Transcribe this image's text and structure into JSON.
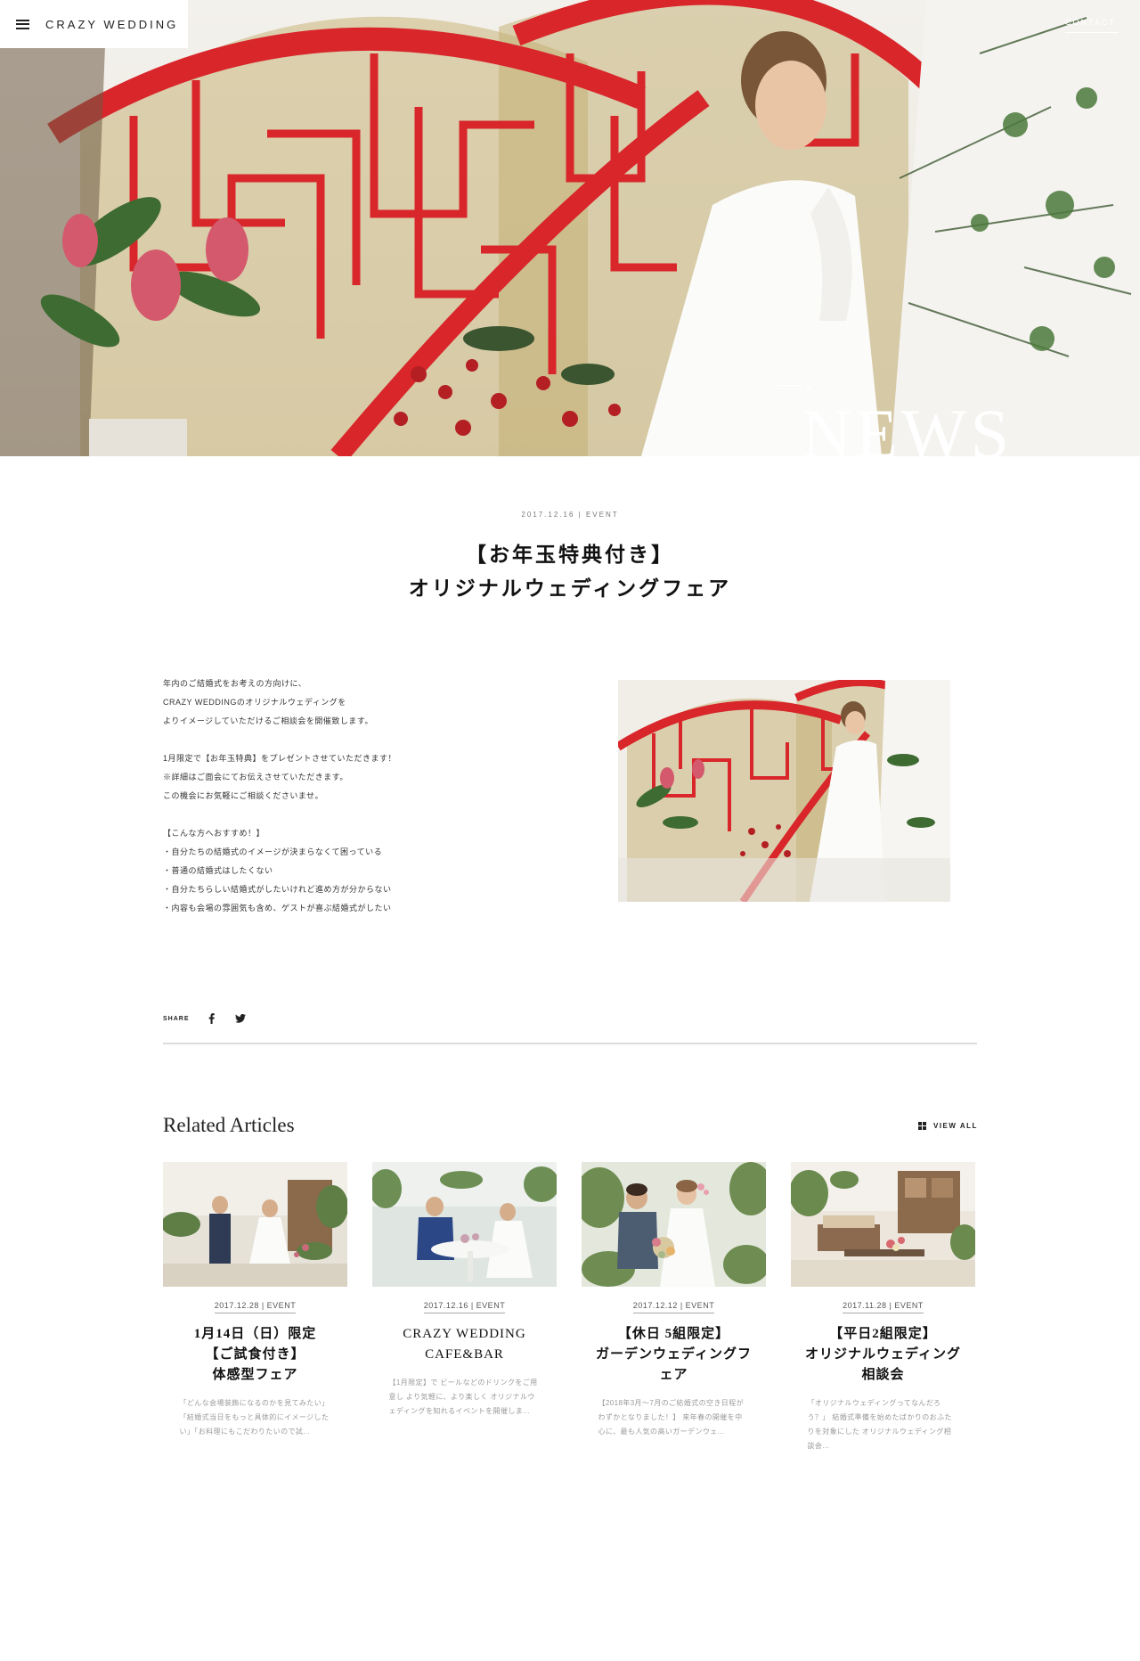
{
  "header": {
    "brand": "CRAZY WEDDING",
    "contact_label": "CONTACT",
    "hero_title": "NEWS"
  },
  "article": {
    "meta": "2017.12.16 | EVENT",
    "title_lines": [
      "【お年玉特典付き】",
      "オリジナルウェディングフェア"
    ],
    "paragraphs": [
      [
        "年内のご結婚式をお考えの方向けに、",
        "CRAZY WEDDINGのオリジナルウェディングを",
        "よりイメージしていただけるご相談会を開催致します。"
      ],
      [
        "1月限定で【お年玉特典】をプレゼントさせていただきます！",
        "※詳細はご面会にてお伝えさせていただきます。",
        "この機会にお気軽にご相談くださいませ。"
      ],
      [
        "【こんな方へおすすめ！】",
        "・自分たちの結婚式のイメージが決まらなくて困っている",
        "・普通の結婚式はしたくない",
        "・自分たちらしい結婚式がしたいけれど進め方が分からない",
        "・内容も会場の雰囲気も含め、ゲストが喜ぶ結婚式がしたい"
      ]
    ]
  },
  "share": {
    "label": "SHARE",
    "icons": [
      "facebook-icon",
      "twitter-icon"
    ]
  },
  "related": {
    "title": "Related Articles",
    "view_all_label": "VIEW ALL",
    "cards": [
      {
        "meta": "2017.12.28 | EVENT",
        "title_lines": [
          "1月14日（日）限定",
          "【ご試食付き】",
          "体感型フェア"
        ],
        "excerpt": "「どんな会場装飾になるのかを見てみたい」「結婚式当日をもっと具体的にイメージしたい」「お料理にもこだわりたいので試..."
      },
      {
        "meta": "2017.12.16 | EVENT",
        "title_lines": [
          "CRAZY WEDDING",
          "CAFE&BAR"
        ],
        "excerpt": "【1月限定】で ビールなどのドリンクをご用意し より気軽に、より楽しく オリジナルウェディングを知れるイベントを開催しま..."
      },
      {
        "meta": "2017.12.12 | EVENT",
        "title_lines": [
          "【休日 5組限定】",
          "ガーデンウェディングフ",
          "ェア"
        ],
        "excerpt": "【2018年3月～7月のご結婚式の空き日程がわずかとなりました！】 来年春の開催を中心に、最も人気の高いガーデンウェ..."
      },
      {
        "meta": "2017.11.28 | EVENT",
        "title_lines": [
          "【平日2組限定】",
          "オリジナルウェディング",
          "相談会"
        ],
        "excerpt": "「オリジナルウェディングってなんだろう？」 結婚式準備を始めたばかりのおふたりを対象にした オリジナルウェディング相談会..."
      }
    ]
  },
  "colors": {
    "accent_red": "#d8262a",
    "gold": "#c9b57a",
    "text": "#222222",
    "muted": "#9a9a9a"
  }
}
